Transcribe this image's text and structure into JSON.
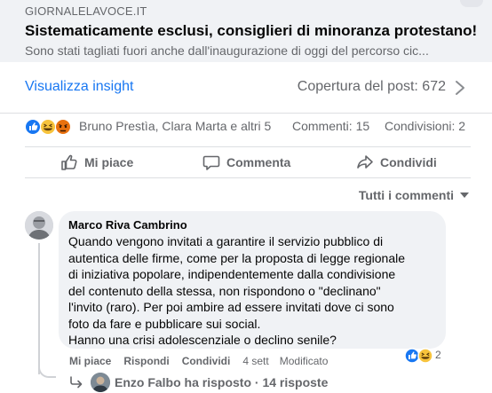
{
  "link_preview": {
    "source": "GIORNALELAVOCE.IT",
    "title": "Sistematicamente esclusi, consiglieri di minoranza protestano!",
    "description": "Sono stati tagliati fuori anche dall'inaugurazione di oggi del percorso cic..."
  },
  "insights": {
    "link_label": "Visualizza insight",
    "reach_label": "Copertura del post: 672"
  },
  "stats": {
    "reaction_icons": [
      "like-icon",
      "haha-icon",
      "angry-icon"
    ],
    "reacted_by": "Bruno Prestìa, Clara Marta e altri 5",
    "comments": "Commenti: 15",
    "shares": "Condivisioni: 2"
  },
  "actions": {
    "like": "Mi piace",
    "comment": "Commenta",
    "share": "Condividi"
  },
  "comments_filter": "Tutti i commenti",
  "comment": {
    "author": "Marco Riva Cambrino",
    "lines": [
      "Quando vengono invitati a garantire il servizio pubblico di",
      "autentica delle firme, come per la proposta di legge regionale",
      "di iniziativa popolare, indipendentemente dalla condivisione",
      "del contenuto della stessa, non rispondono o \"declinano\"",
      "l'invito (raro). Per poi ambire ad essere invitati dove ci sono",
      "foto da fare e pubblicare sui social.",
      "Hanno una crisi adolescenziale o declino senile?"
    ],
    "reaction_count": "2",
    "like_label": "Mi piace",
    "reply_label": "Rispondi",
    "share_label": "Condividi",
    "time": "4 sett",
    "edited": "Modificato"
  },
  "replies": {
    "text": "Enzo Falbo ha risposto · 14 risposte"
  },
  "colors": {
    "accent": "#1877f2",
    "muted_text": "#65676b",
    "bubble_bg": "#f0f2f5",
    "preview_bg": "#f0f2f5"
  }
}
